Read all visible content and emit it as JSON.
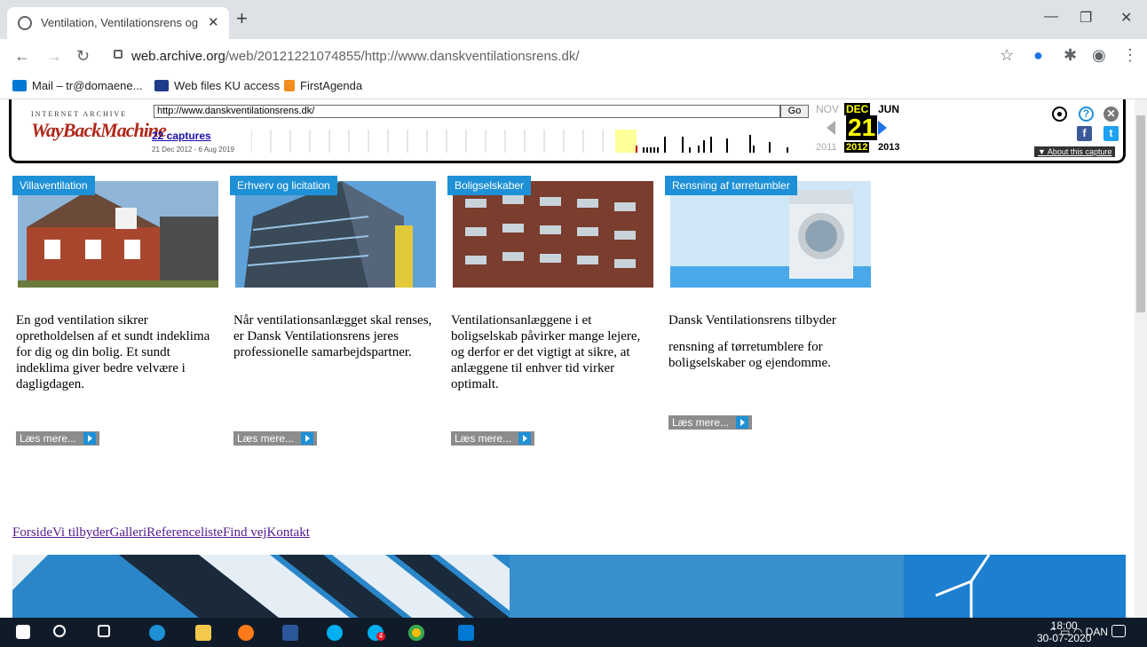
{
  "browser": {
    "tab_title": "Ventilation, Ventilationsrens og V",
    "url_host": "web.archive.org",
    "url_path": "/web/20121221074855/http://www.danskventilationsrens.dk/",
    "bookmarks": [
      {
        "label": "Mail – tr@domaene...",
        "color": "#0078d4"
      },
      {
        "label": "Web files KU access",
        "color": "#1f3b8a"
      },
      {
        "label": "FirstAgenda",
        "color": "#f28c1e"
      }
    ]
  },
  "wayback": {
    "logo_top": "INTERNET ARCHIVE",
    "logo": "WayBackMachine",
    "url_value": "http://www.danskventilationsrens.dk/",
    "go_label": "Go",
    "captures": "22 captures",
    "range": "21 Dec 2012 - 6 Aug 2019",
    "prev_month": "NOV",
    "cur_month": "DEC",
    "next_month": "JUN",
    "day": "21",
    "prev_year": "2011",
    "cur_year": "2012",
    "next_year": "2013",
    "about": "▼ About this capture"
  },
  "cards": [
    {
      "title": "Villaventilation",
      "text": "En god ventilation sikrer opretholdelsen af et sundt indeklima for dig og din bolig. Et sundt indeklima giver bedre velvære i dagligdagen.",
      "more": "Læs mere..."
    },
    {
      "title": "Erhverv og licitation",
      "text": "Når ventilationsanlægget skal renses, er Dansk Ventilationsrens jeres professionelle samarbejdspartner.",
      "more": "Læs mere..."
    },
    {
      "title": "Boligselskaber",
      "text": "Ventilationsanlæggene i et boligselskab påvirker mange lejere, og derfor er det vigtigt at sikre, at anlæggene til enhver tid virker optimalt.",
      "more": "Læs mere..."
    },
    {
      "title": "Rensning af tørretumbler",
      "text": "Dansk Ventilationsrens tilbyder",
      "text2": "rensning af tørretumblere for boligselskaber og ejendomme.",
      "more": "Læs mere..."
    }
  ],
  "sitenav": [
    "Forside",
    "Vi tilbyder",
    "Galleri",
    "Referenceliste",
    "Find vej",
    "Kontakt"
  ],
  "taskbar": {
    "lang": "DAN",
    "time": "18:00",
    "date": "30-07-2020",
    "skype_badge": "4"
  }
}
